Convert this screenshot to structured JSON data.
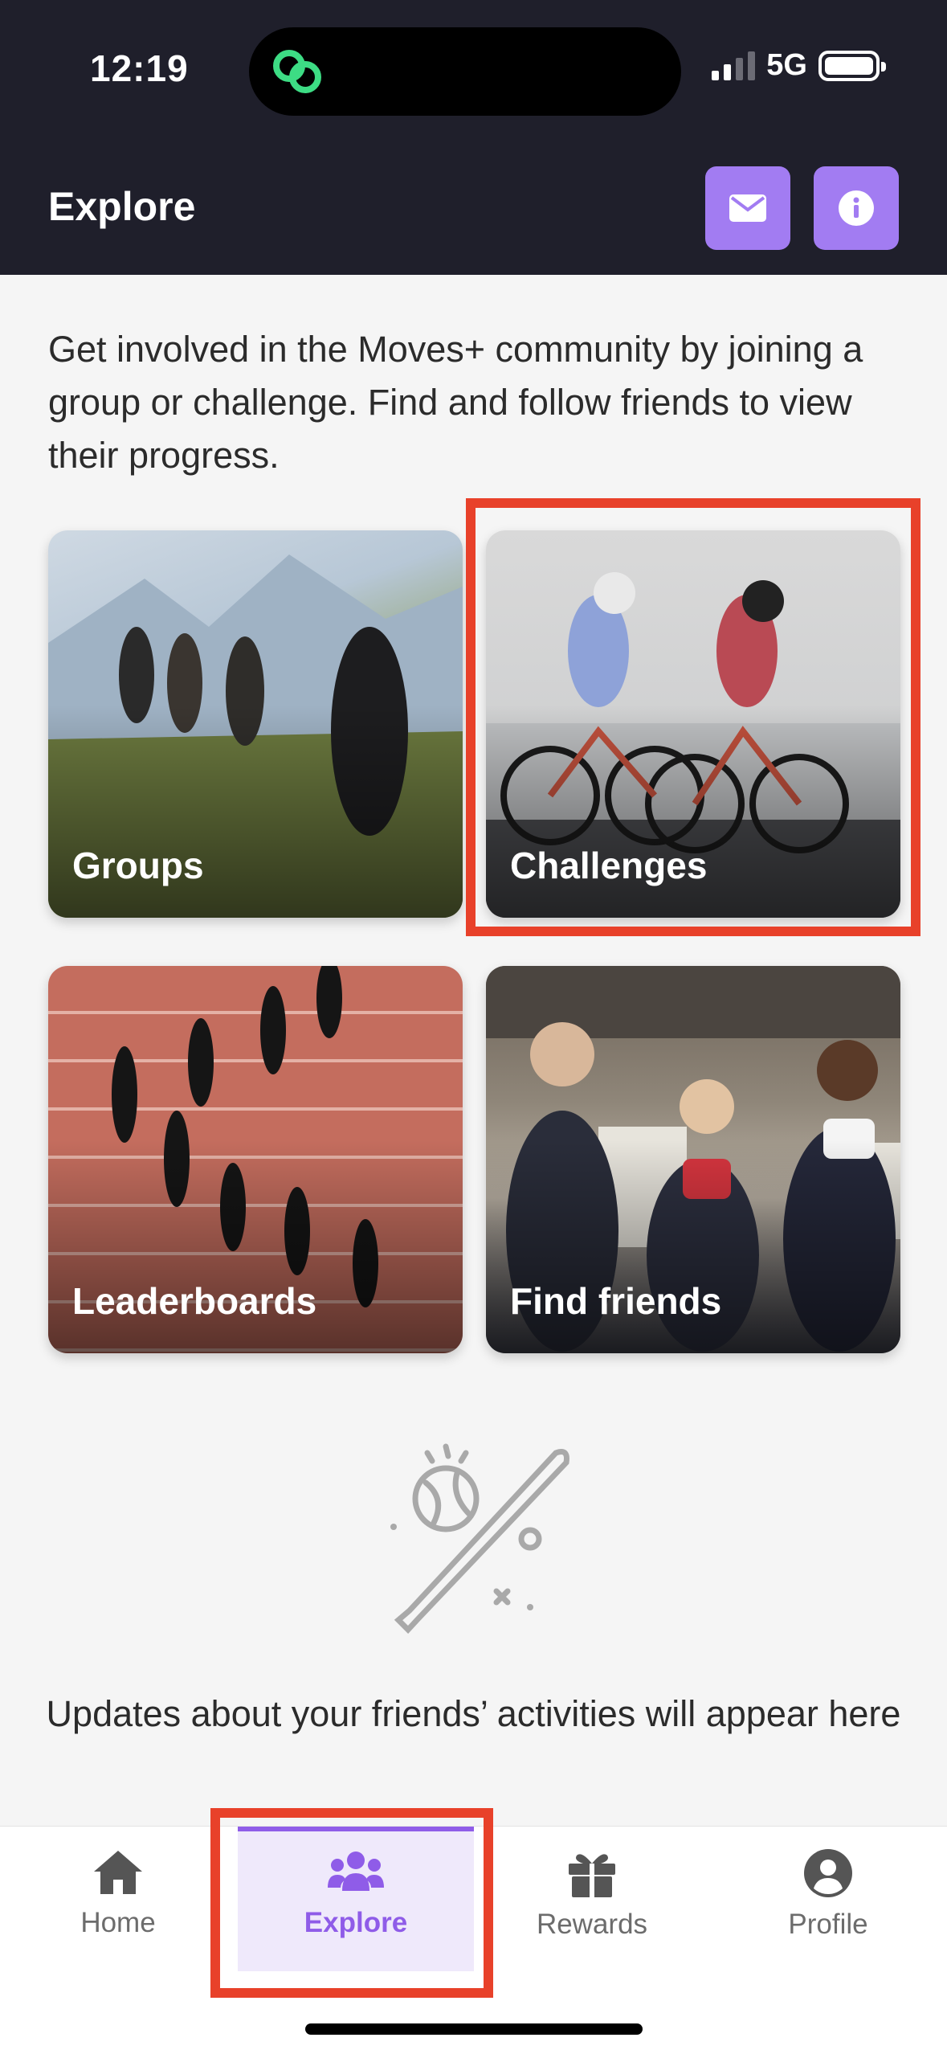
{
  "status_bar": {
    "time": "12:19",
    "network": "5G"
  },
  "header": {
    "title": "Explore",
    "accent_color": "#a27cf2",
    "background_color": "#1f1f2b",
    "buttons": [
      {
        "icon": "envelope-icon"
      },
      {
        "icon": "info-icon"
      }
    ]
  },
  "intro_text": "Get involved in the Moves+ community by joining a group or challenge. Find and follow friends to view their progress.",
  "tiles": {
    "groups": "Groups",
    "challenges": "Challenges",
    "leaderboards": "Leaderboards",
    "find_friends": "Find friends"
  },
  "empty_state": {
    "icon": "baseball-bat-icon",
    "text": "Updates about your friends’ activities will appear here"
  },
  "tabbar": {
    "active": "Explore",
    "active_color": "#8f5ce8",
    "items": [
      {
        "label": "Home",
        "icon": "home-icon"
      },
      {
        "label": "Explore",
        "icon": "users-icon"
      },
      {
        "label": "Rewards",
        "icon": "gift-icon"
      },
      {
        "label": "Profile",
        "icon": "user-circle-icon"
      }
    ]
  },
  "highlight_color": "#e8412a"
}
